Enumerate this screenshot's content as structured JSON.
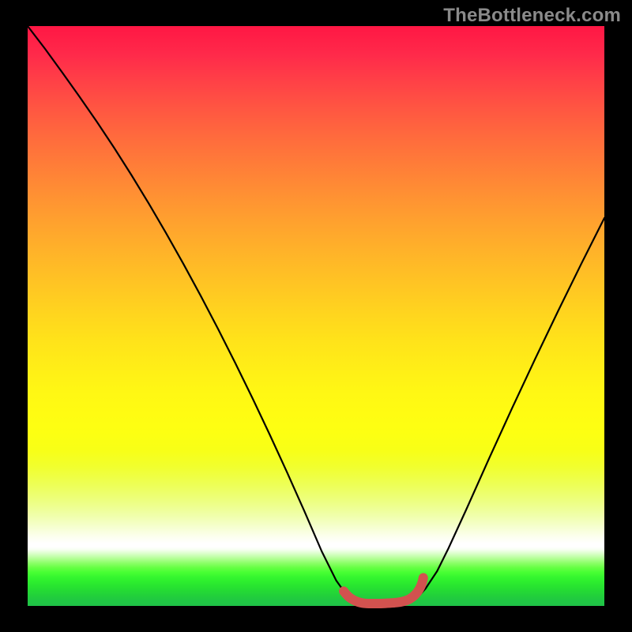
{
  "watermark": "TheBottleneck.com",
  "chart_data": {
    "type": "line",
    "title": "",
    "xlabel": "",
    "ylabel": "",
    "xlim": [
      0,
      100
    ],
    "ylim": [
      0,
      100
    ],
    "series": [
      {
        "name": "bottleneck-curve",
        "color": "#000000",
        "x": [
          0,
          3,
          6,
          9,
          12,
          15,
          18,
          21,
          24,
          27,
          30,
          33,
          36,
          39,
          42,
          45,
          48,
          51,
          53.5,
          55,
          56,
          57,
          58,
          59,
          60,
          61,
          62,
          63,
          64,
          65,
          66,
          67,
          68,
          69,
          71,
          73,
          76,
          80,
          84,
          88,
          92,
          96,
          100
        ],
        "y": [
          100,
          96.1,
          92.0,
          87.8,
          83.5,
          79.0,
          74.3,
          69.4,
          64.3,
          59.0,
          53.5,
          47.8,
          41.9,
          35.8,
          29.5,
          23.0,
          16.3,
          9.4,
          4.4,
          2.3,
          1.4,
          0.85,
          0.55,
          0.42,
          0.4,
          0.4,
          0.42,
          0.45,
          0.5,
          0.6,
          0.8,
          1.2,
          1.9,
          3.0,
          6.0,
          10.0,
          16.5,
          25.4,
          34.1,
          42.6,
          50.9,
          59.0,
          66.9
        ]
      },
      {
        "name": "sweet-spot-band",
        "color": "#d2524f",
        "x": [
          54.8,
          55.2,
          55.6,
          56.0,
          56.4,
          56.8,
          57.2,
          57.6,
          58.0,
          58.4,
          58.8,
          59.2,
          59.6,
          60.0,
          60.4,
          60.8,
          61.2,
          61.6,
          62.0,
          62.4,
          62.8,
          63.2,
          63.6,
          64.0,
          64.4,
          64.8,
          65.2,
          65.6,
          66.0,
          66.4,
          66.8,
          67.2,
          67.58,
          67.92,
          68.22,
          68.45,
          68.6
        ],
        "y": [
          2.55,
          2.05,
          1.64,
          1.33,
          1.08,
          0.88,
          0.72,
          0.6,
          0.51,
          0.45,
          0.42,
          0.4,
          0.4,
          0.4,
          0.4,
          0.4,
          0.41,
          0.43,
          0.45,
          0.47,
          0.49,
          0.52,
          0.55,
          0.59,
          0.64,
          0.71,
          0.8,
          0.92,
          1.08,
          1.3,
          1.58,
          1.94,
          2.38,
          2.9,
          3.5,
          4.16,
          4.85
        ]
      }
    ],
    "gradient_background": {
      "direction": "top-to-bottom",
      "stops": [
        {
          "pos": 0.0,
          "color": "#ff1744"
        },
        {
          "pos": 0.5,
          "color": "#ffd31f"
        },
        {
          "pos": 0.7,
          "color": "#fdff12"
        },
        {
          "pos": 0.89,
          "color": "#ffffff"
        },
        {
          "pos": 1.0,
          "color": "#1fc248"
        }
      ]
    }
  }
}
